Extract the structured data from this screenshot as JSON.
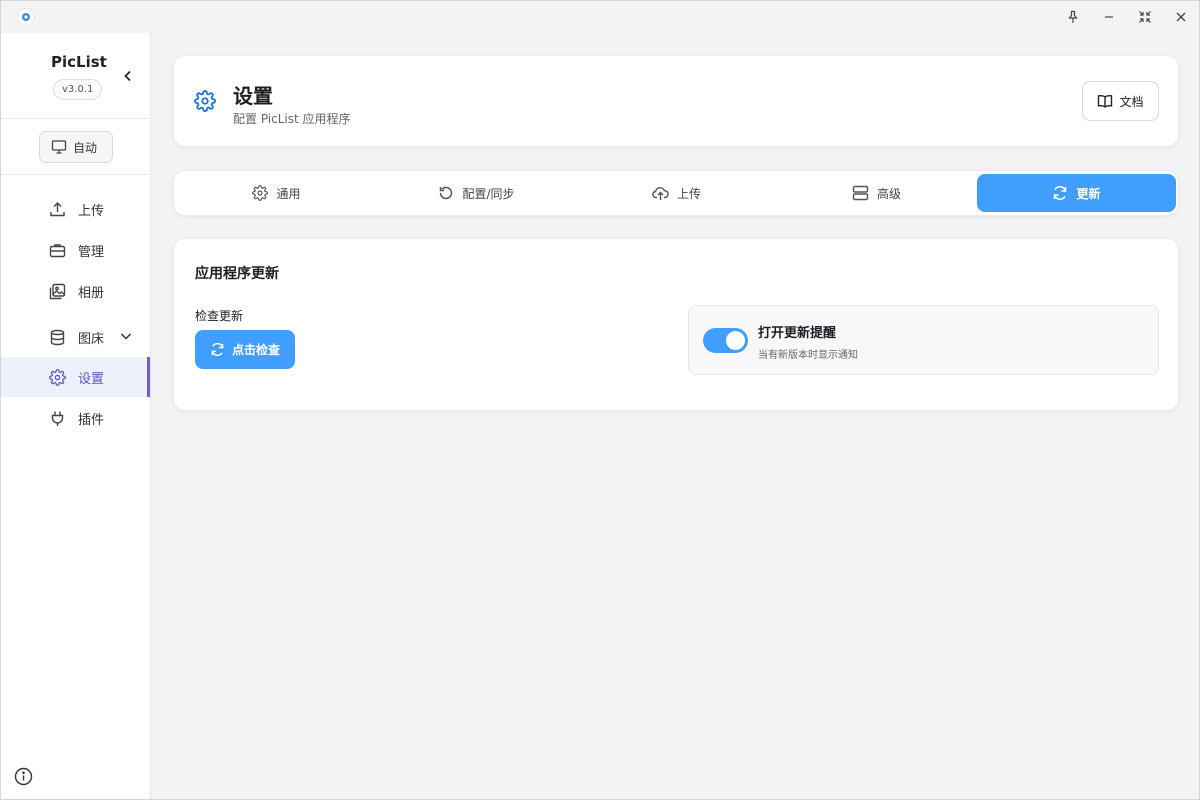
{
  "app": {
    "name": "PicList",
    "version": "v3.0.1"
  },
  "theme": {
    "label": "自动"
  },
  "sidebar": {
    "items": [
      {
        "label": "上传",
        "icon": "upload-icon"
      },
      {
        "label": "管理",
        "icon": "briefcase-icon"
      },
      {
        "label": "相册",
        "icon": "gallery-icon"
      },
      {
        "label": "图床",
        "icon": "database-icon"
      },
      {
        "label": "设置",
        "icon": "gear-icon",
        "active": true
      },
      {
        "label": "插件",
        "icon": "plug-icon"
      }
    ]
  },
  "header": {
    "title": "设置",
    "subtitle": "配置 PicList 应用程序",
    "docs_label": "文档"
  },
  "tabs": [
    {
      "label": "通用",
      "icon": "gear-icon"
    },
    {
      "label": "配置/同步",
      "icon": "rotate-icon"
    },
    {
      "label": "上传",
      "icon": "cloud-upload-icon"
    },
    {
      "label": "高级",
      "icon": "server-icon"
    },
    {
      "label": "更新",
      "icon": "refresh-icon",
      "active": true
    }
  ],
  "content": {
    "section_title": "应用程序更新",
    "check_label": "检查更新",
    "check_button": "点击检查",
    "notify_title": "打开更新提醒",
    "notify_desc": "当有新版本时显示通知",
    "notify_enabled": true
  },
  "colors": {
    "accent": "#409eff",
    "sidebar_active": "#5a55c8",
    "header_icon": "#1f73d8"
  }
}
